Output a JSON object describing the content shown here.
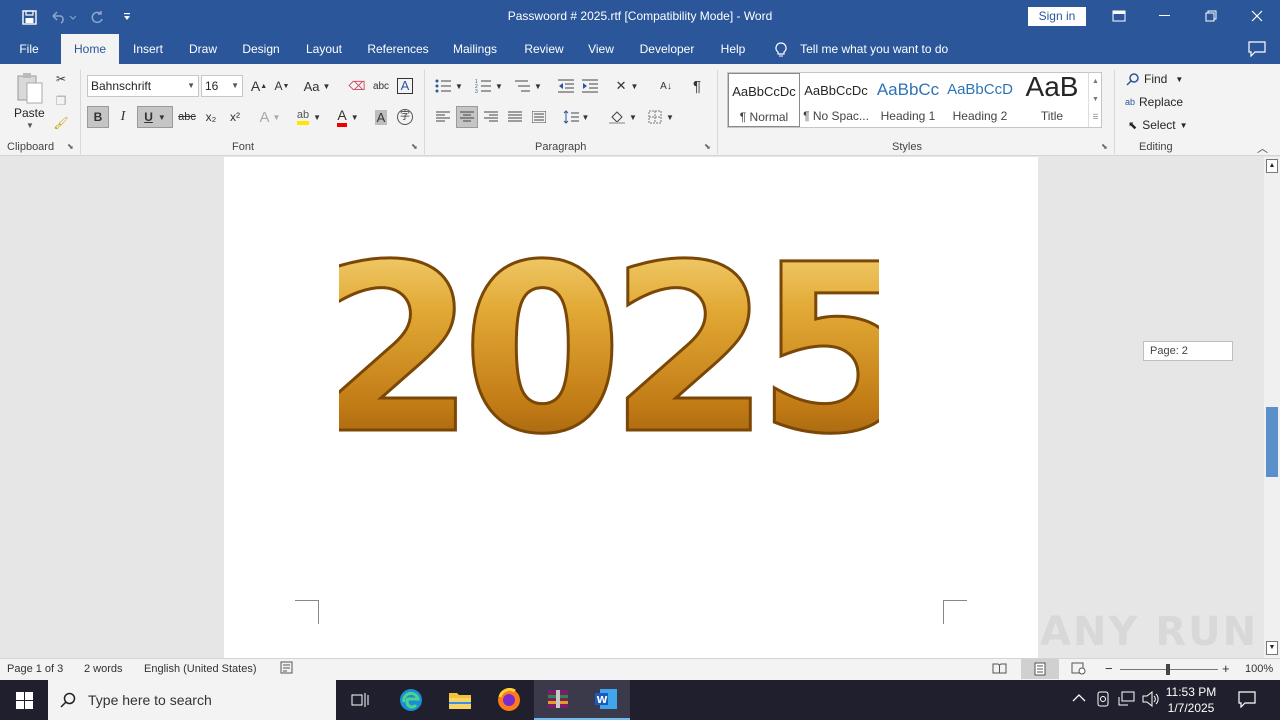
{
  "window": {
    "title": "Passwoord # 2025.rtf [Compatibility Mode]  -  Word",
    "sign_in": "Sign in"
  },
  "tabs": [
    {
      "label": "File"
    },
    {
      "label": "Home"
    },
    {
      "label": "Insert"
    },
    {
      "label": "Draw"
    },
    {
      "label": "Design"
    },
    {
      "label": "Layout"
    },
    {
      "label": "References"
    },
    {
      "label": "Mailings"
    },
    {
      "label": "Review"
    },
    {
      "label": "View"
    },
    {
      "label": "Developer"
    },
    {
      "label": "Help"
    }
  ],
  "tell_me": "Tell me what you want to do",
  "clipboard": {
    "paste": "Paste",
    "group": "Clipboard"
  },
  "font": {
    "name": "Bahnschrift",
    "size": "16",
    "group": "Font",
    "grow": "A",
    "shrink": "A",
    "case": "Aa",
    "bold": "B",
    "italic": "I",
    "underline": "U",
    "strike": "abc",
    "sub": "x₂",
    "sup": "x²"
  },
  "paragraph": {
    "group": "Paragraph"
  },
  "styles": {
    "group": "Styles",
    "items": [
      {
        "preview": "AaBbCcDc",
        "name": "¶ Normal"
      },
      {
        "preview": "AaBbCcDc",
        "name": "¶ No Spac..."
      },
      {
        "preview": "AaBbCc",
        "name": "Heading 1"
      },
      {
        "preview": "AaBbCcD",
        "name": "Heading 2"
      },
      {
        "preview": "AaB",
        "name": "Title"
      }
    ]
  },
  "editing": {
    "group": "Editing",
    "find": "Find",
    "replace": "Replace",
    "select": "Select"
  },
  "document": {
    "image_text": "2025",
    "page_badge": "Page: 2"
  },
  "status": {
    "page": "Page 1 of 3",
    "words": "2 words",
    "language": "English (United States)",
    "zoom": "100%",
    "zoom_minus": "−",
    "zoom_plus": "+"
  },
  "taskbar": {
    "search_placeholder": "Type here to search",
    "time": "11:53 PM",
    "date": "1/7/2025"
  },
  "watermark": "ANY RUN"
}
